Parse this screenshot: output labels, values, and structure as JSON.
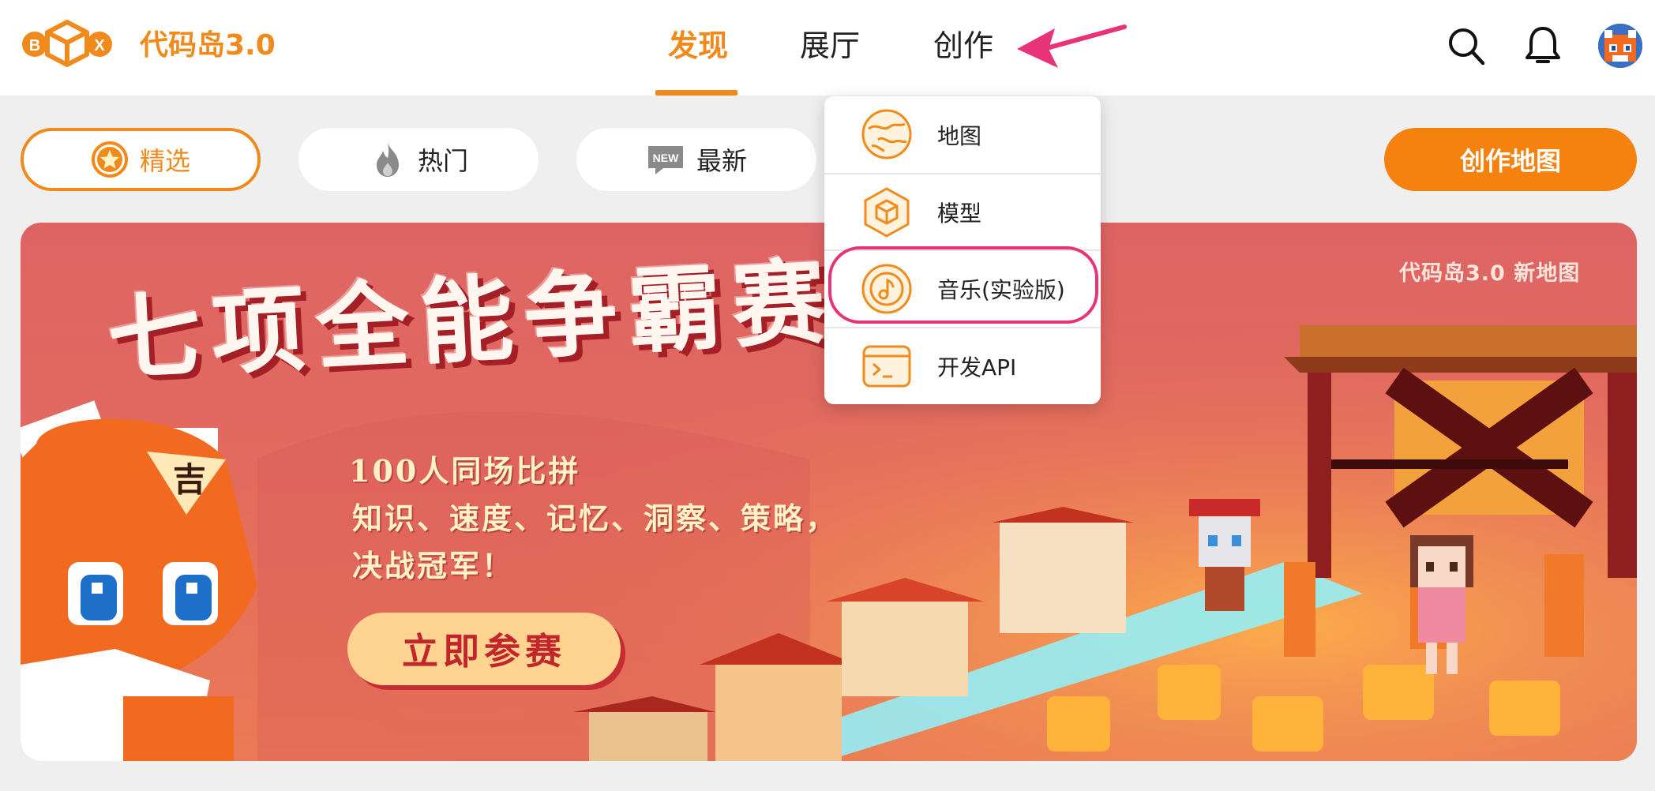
{
  "colors": {
    "accent": "#f08a1c",
    "button_bg": "#f5820f",
    "highlight_ring": "#e83379",
    "annotation_arrow": "#e83379",
    "banner_bg": "#e26a5e"
  },
  "header": {
    "logo_letters": [
      "B",
      "X"
    ],
    "app_title": "代码岛3.0",
    "nav": {
      "discover": "发现",
      "gallery": "展厅",
      "create": "创作",
      "active": "discover"
    },
    "icons": [
      "search-icon",
      "bell-icon",
      "avatar"
    ]
  },
  "filters": {
    "featured": "精选",
    "hot": "热门",
    "newest": "最新",
    "new_badge": "NEW",
    "selected": "featured"
  },
  "create_map_button": "创作地图",
  "create_menu": {
    "items": [
      {
        "label": "地图",
        "icon": "map-icon"
      },
      {
        "label": "模型",
        "icon": "cube-icon"
      },
      {
        "label": "音乐(实验版)",
        "icon": "music-note-icon",
        "highlighted": true
      },
      {
        "label": "开发API",
        "icon": "terminal-icon"
      }
    ]
  },
  "banner": {
    "tag": "代码岛3.0 新地图",
    "title": "七项全能争霸赛！",
    "line1": "100人同场比拼",
    "line2": "知识、速度、记忆、洞察、策略，",
    "line3": "决战冠军！",
    "cta": "立即参赛"
  }
}
